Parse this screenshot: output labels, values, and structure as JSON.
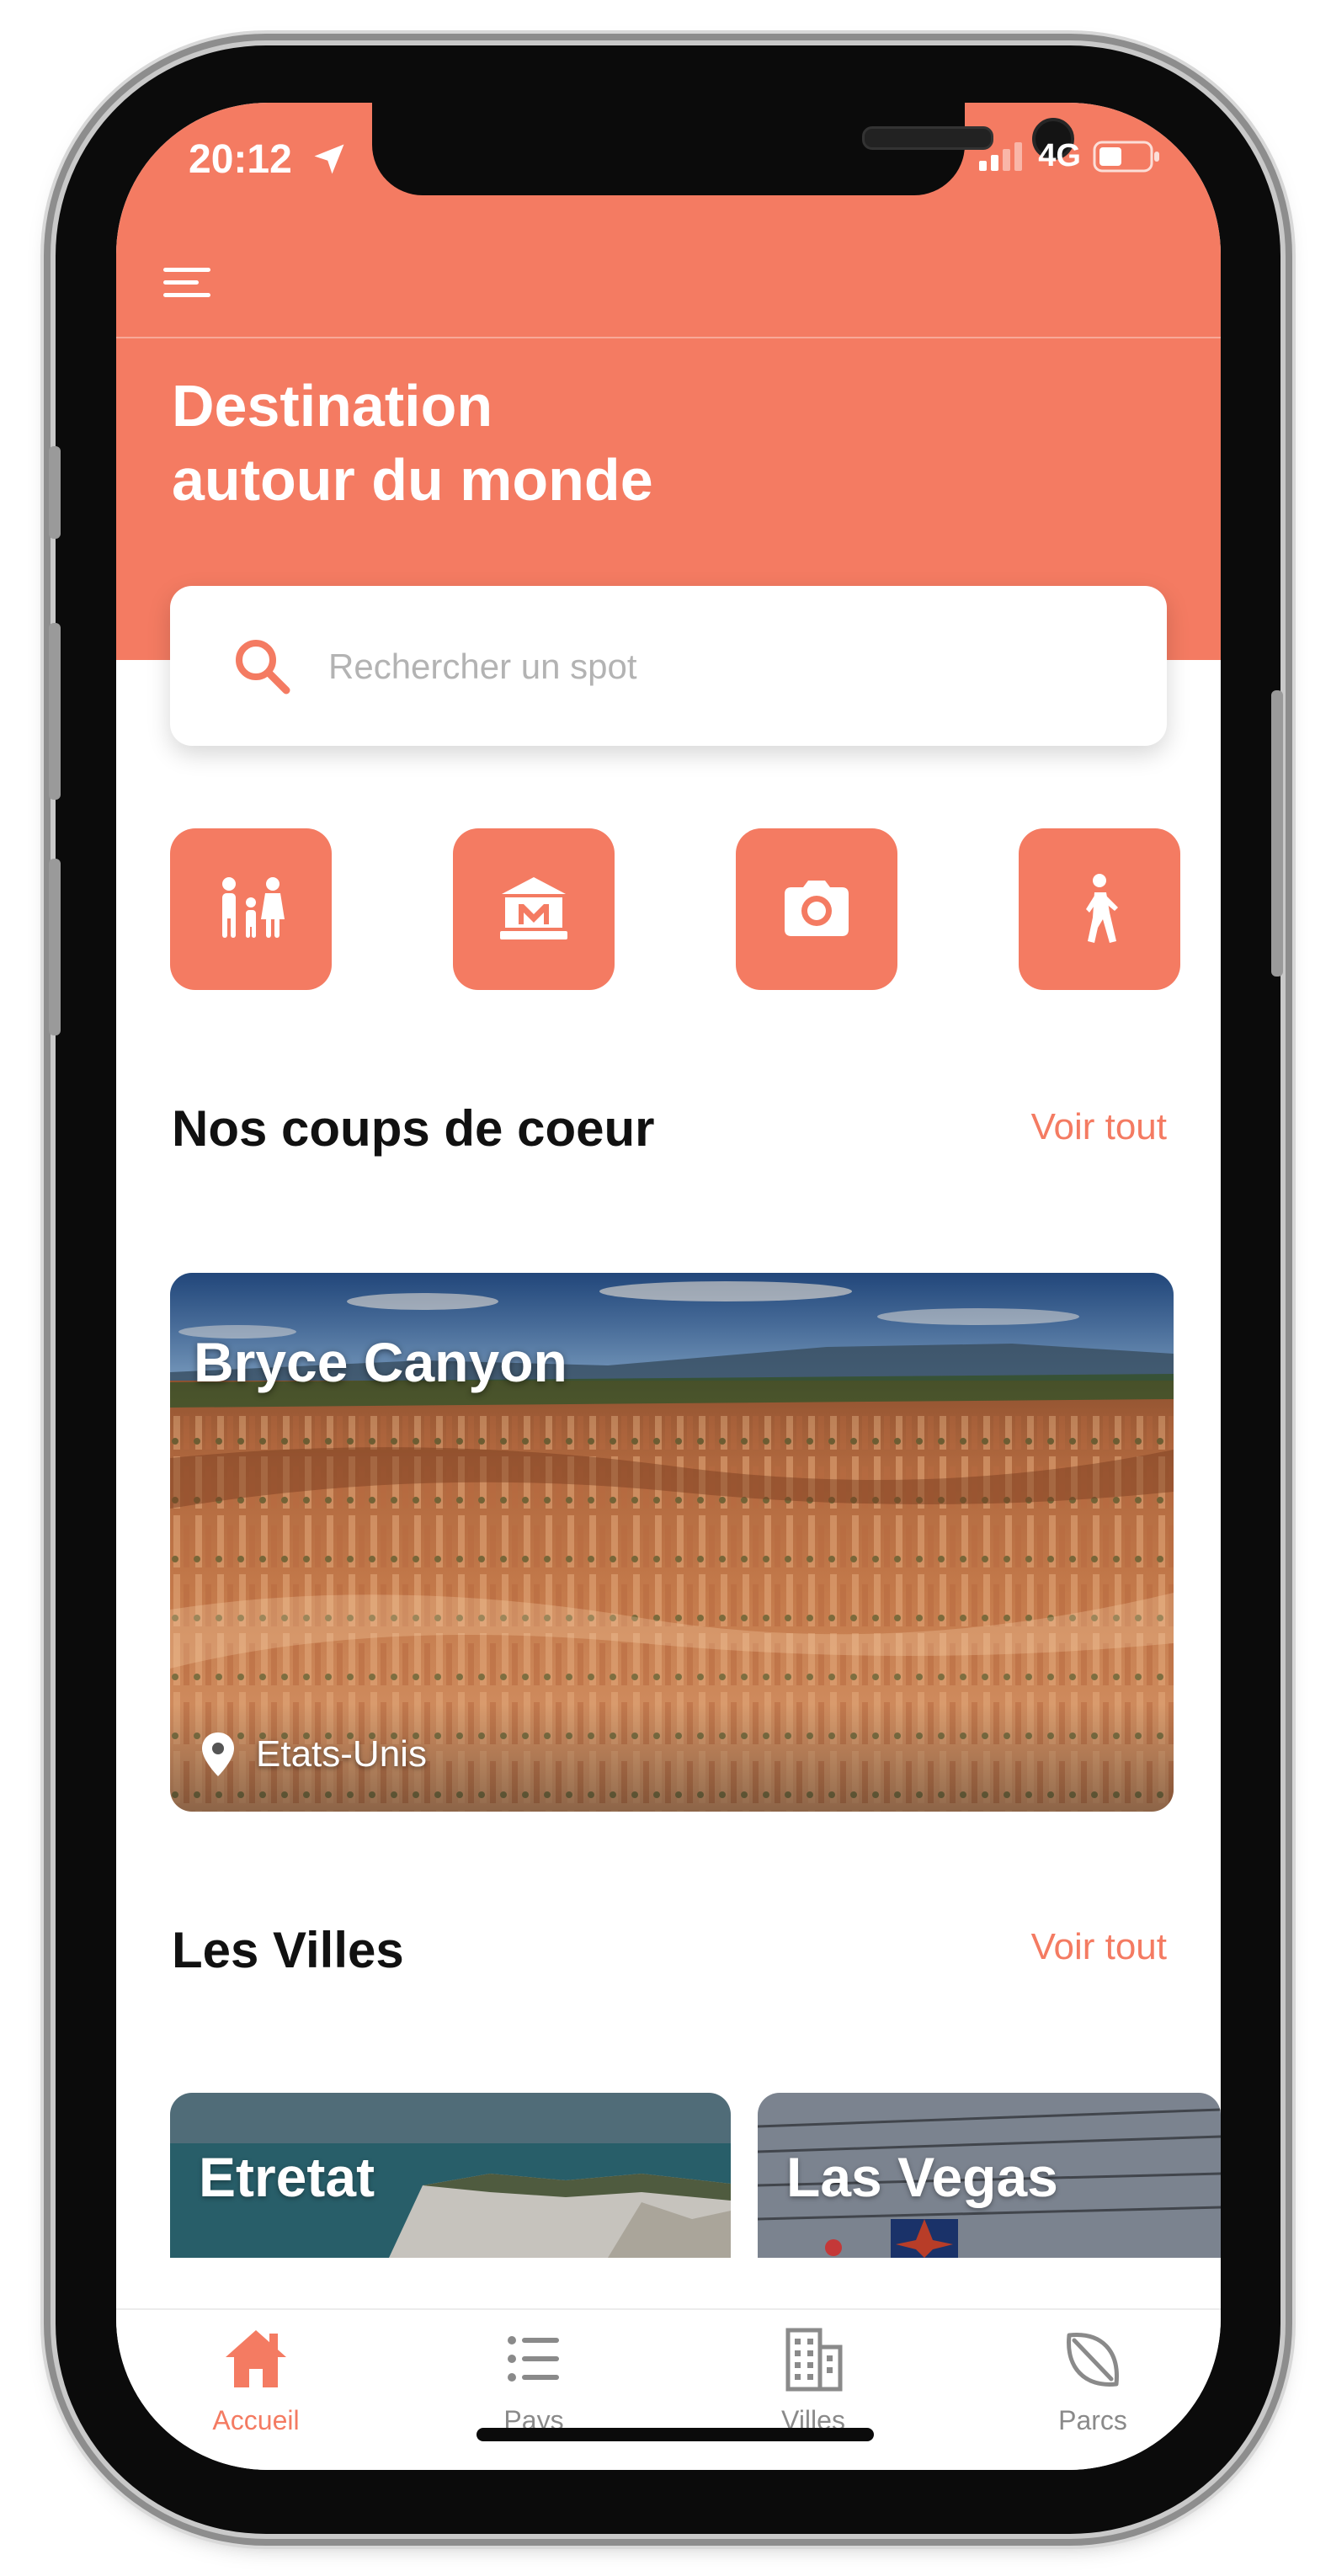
{
  "colors": {
    "accent": "#F47B62",
    "text": "#111111",
    "muted": "#8A8A8A"
  },
  "status_bar": {
    "time": "20:12",
    "network": "4G"
  },
  "header": {
    "title_line1": "Destination",
    "title_line2": "autour du monde"
  },
  "search": {
    "placeholder": "Rechercher un spot"
  },
  "categories": [
    {
      "icon": "family-icon"
    },
    {
      "icon": "museum-icon"
    },
    {
      "icon": "camera-icon"
    },
    {
      "icon": "hiking-icon"
    }
  ],
  "favorites": {
    "title": "Nos coups de coeur",
    "see_all": "Voir tout",
    "card": {
      "title": "Bryce Canyon",
      "location": "Etats-Unis"
    }
  },
  "cities": {
    "title": "Les Villes",
    "see_all": "Voir tout",
    "items": [
      {
        "name": "Etretat"
      },
      {
        "name": "Las Vegas"
      }
    ]
  },
  "tabbar": {
    "items": [
      {
        "label": "Accueil",
        "icon": "home-icon",
        "active": true
      },
      {
        "label": "Pays",
        "icon": "list-icon",
        "active": false
      },
      {
        "label": "Villes",
        "icon": "building-icon",
        "active": false
      },
      {
        "label": "Parcs",
        "icon": "leaf-icon",
        "active": false
      }
    ]
  }
}
